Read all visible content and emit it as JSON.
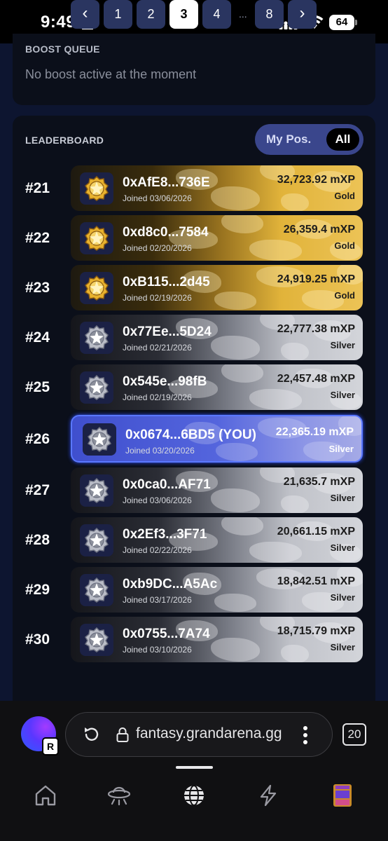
{
  "status_bar": {
    "time": "9:49",
    "battery": "64"
  },
  "boost_queue": {
    "title": "BOOST QUEUE",
    "empty_text": "No boost active at the moment"
  },
  "leaderboard": {
    "title": "LEADERBOARD",
    "toggle": {
      "my_pos": "My Pos.",
      "all": "All",
      "selected": "All"
    },
    "rows": [
      {
        "rank": "#21",
        "address": "0xAfE8...736E",
        "joined": "Joined 03/06/2026",
        "xp": "32,723.92 mXP",
        "tier": "Gold",
        "badge": "gold-star-badge-icon"
      },
      {
        "rank": "#22",
        "address": "0xd8c0...7584",
        "joined": "Joined 02/20/2026",
        "xp": "26,359.4 mXP",
        "tier": "Gold",
        "badge": "gold-star-badge-icon"
      },
      {
        "rank": "#23",
        "address": "0xB115...2d45",
        "joined": "Joined 02/19/2026",
        "xp": "24,919.25 mXP",
        "tier": "Gold",
        "badge": "gold-star-badge-icon"
      },
      {
        "rank": "#24",
        "address": "0x77Ee...5D24",
        "joined": "Joined 02/21/2026",
        "xp": "22,777.38 mXP",
        "tier": "Silver",
        "badge": "silver-star-badge-icon"
      },
      {
        "rank": "#25",
        "address": "0x545e...98fB",
        "joined": "Joined 02/19/2026",
        "xp": "22,457.48 mXP",
        "tier": "Silver",
        "badge": "silver-star-badge-icon"
      },
      {
        "rank": "#26",
        "address": "0x0674...6BD5 (YOU)",
        "joined": "Joined 03/20/2026",
        "xp": "22,365.19 mXP",
        "tier": "Silver",
        "badge": "silver-star-badge-icon",
        "is_you": true
      },
      {
        "rank": "#27",
        "address": "0x0ca0...AF71",
        "joined": "Joined 03/06/2026",
        "xp": "21,635.7 mXP",
        "tier": "Silver",
        "badge": "silver-star-badge-icon"
      },
      {
        "rank": "#28",
        "address": "0x2Ef3...3F71",
        "joined": "Joined 02/22/2026",
        "xp": "20,661.15 mXP",
        "tier": "Silver",
        "badge": "silver-star-badge-icon"
      },
      {
        "rank": "#29",
        "address": "0xb9DC...A5Ac",
        "joined": "Joined 03/17/2026",
        "xp": "18,842.51 mXP",
        "tier": "Silver",
        "badge": "silver-star-badge-icon"
      },
      {
        "rank": "#30",
        "address": "0x0755...7A74",
        "joined": "Joined 03/10/2026",
        "xp": "18,715.79 mXP",
        "tier": "Silver",
        "badge": "silver-star-badge-icon"
      }
    ]
  },
  "pagination": {
    "prev": "‹",
    "pages": [
      "1",
      "2",
      "3",
      "4"
    ],
    "ellipsis": "...",
    "last": "8",
    "next": "›",
    "current": "3"
  },
  "browser": {
    "url": "fantasy.grandarena.gg",
    "tab_count": "20",
    "avatar_badge": "R"
  },
  "colors": {
    "page_bg": "#0d1530",
    "card_bg": "#0b0f1a",
    "gold": "#e1b33a",
    "silver": "#bfc1c8",
    "you_highlight": "#4a5ad6",
    "toggle_bg": "#3a468c"
  }
}
